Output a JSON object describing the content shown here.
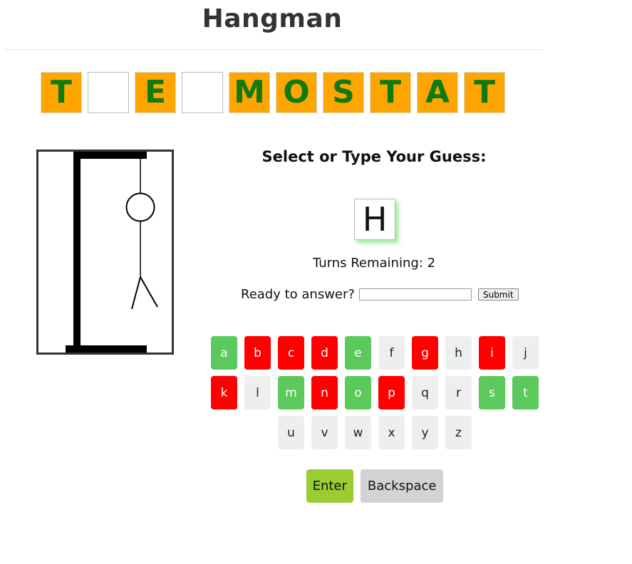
{
  "app": {
    "title": "Hangman"
  },
  "word": {
    "letters": [
      "T",
      "",
      "E",
      "",
      "M",
      "O",
      "S",
      "T",
      "A",
      "T"
    ]
  },
  "game": {
    "prompt": "Select or Type Your Guess:",
    "current_guess": "H",
    "turns_label": "Turns Remaining: 2",
    "answer_label": "Ready to answer?",
    "answer_value": "",
    "submit_label": "Submit"
  },
  "keyboard": {
    "rows": [
      [
        {
          "letter": "a",
          "state": "correct"
        },
        {
          "letter": "b",
          "state": "wrong"
        },
        {
          "letter": "c",
          "state": "wrong"
        },
        {
          "letter": "d",
          "state": "wrong"
        },
        {
          "letter": "e",
          "state": "correct"
        },
        {
          "letter": "f",
          "state": "unused"
        },
        {
          "letter": "g",
          "state": "wrong"
        },
        {
          "letter": "h",
          "state": "unused"
        },
        {
          "letter": "i",
          "state": "wrong"
        },
        {
          "letter": "j",
          "state": "unused"
        }
      ],
      [
        {
          "letter": "k",
          "state": "wrong"
        },
        {
          "letter": "l",
          "state": "unused"
        },
        {
          "letter": "m",
          "state": "correct"
        },
        {
          "letter": "n",
          "state": "wrong"
        },
        {
          "letter": "o",
          "state": "correct"
        },
        {
          "letter": "p",
          "state": "wrong"
        },
        {
          "letter": "q",
          "state": "unused"
        },
        {
          "letter": "r",
          "state": "unused"
        },
        {
          "letter": "s",
          "state": "correct"
        },
        {
          "letter": "t",
          "state": "correct"
        }
      ],
      [
        {
          "letter": "u",
          "state": "unused"
        },
        {
          "letter": "v",
          "state": "unused"
        },
        {
          "letter": "w",
          "state": "unused"
        },
        {
          "letter": "x",
          "state": "unused"
        },
        {
          "letter": "y",
          "state": "unused"
        },
        {
          "letter": "z",
          "state": "unused"
        }
      ]
    ],
    "enter_label": "Enter",
    "backspace_label": "Backspace"
  },
  "colors": {
    "tile_bg": "#ffa500",
    "tile_text": "#0f7a0f",
    "correct": "#5cc95c",
    "wrong": "#ff0000",
    "unused": "#eeeeee",
    "enter": "#9acd32",
    "backspace": "#d3d3d3"
  }
}
